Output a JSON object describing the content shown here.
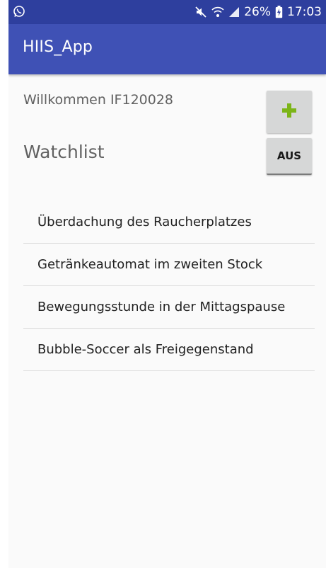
{
  "status_bar": {
    "battery_percent": "26%",
    "time": "17:03",
    "background_color": "#2e3f9e",
    "icons": [
      "whatsapp-icon",
      "mute-icon",
      "wifi-icon",
      "signal-icon",
      "battery-charging-icon"
    ]
  },
  "app_bar": {
    "title": "HIIS_App",
    "background_color": "#3f51b5"
  },
  "header": {
    "welcome_text": "Willkommen IF120028",
    "watchlist_title": "Watchlist"
  },
  "buttons": {
    "add_icon": "plus-icon",
    "add_icon_color": "#7cb518",
    "off_label": "AUS"
  },
  "watchlist": {
    "items": [
      "Überdachung des Raucherplatzes",
      "Getränkeautomat im zweiten Stock",
      "Bewegungsstunde in der Mittagspause",
      "Bubble-Soccer als Freigegenstand"
    ]
  }
}
